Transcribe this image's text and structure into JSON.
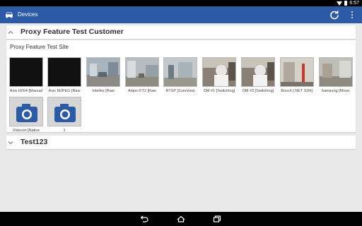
{
  "status_bar": {
    "time": "6:57",
    "icons": [
      "wifi-icon",
      "battery-icon"
    ]
  },
  "app_bar": {
    "title": "Devices",
    "app_icon": "car-icon",
    "actions": [
      "refresh-icon",
      "overflow-menu-icon"
    ],
    "background": "#2d5aa6"
  },
  "customers": [
    {
      "name": "Proxy Feature Test Customer",
      "expanded": true
    },
    {
      "name": "Test123",
      "expanded": false
    }
  ],
  "site": {
    "name": "Proxy Feature Test Site",
    "devices": [
      {
        "label": "Axis H264 [Manual",
        "thumb": "black"
      },
      {
        "label": "Axis MJPEG [Raw",
        "thumb": "black"
      },
      {
        "label": "Intellex [Raw",
        "thumb": "street"
      },
      {
        "label": "Adpro FT2 [Raw",
        "thumb": "street"
      },
      {
        "label": "RTSP [SureView",
        "thumb": "street-wide"
      },
      {
        "label": "DM #1 [Switching]",
        "thumb": "person"
      },
      {
        "label": "DM #3 [Switching]",
        "thumb": "person"
      },
      {
        "label": "Bosch [.NET SDK]",
        "thumb": "indoor"
      },
      {
        "label": "Samsung [Move,",
        "thumb": "street"
      },
      {
        "label": "Videcon [Native",
        "thumb": "camera-icon"
      },
      {
        "label": "1",
        "thumb": "camera-icon"
      }
    ]
  },
  "nav_bar": {
    "buttons": [
      "back-icon",
      "home-icon",
      "recents-icon"
    ]
  }
}
